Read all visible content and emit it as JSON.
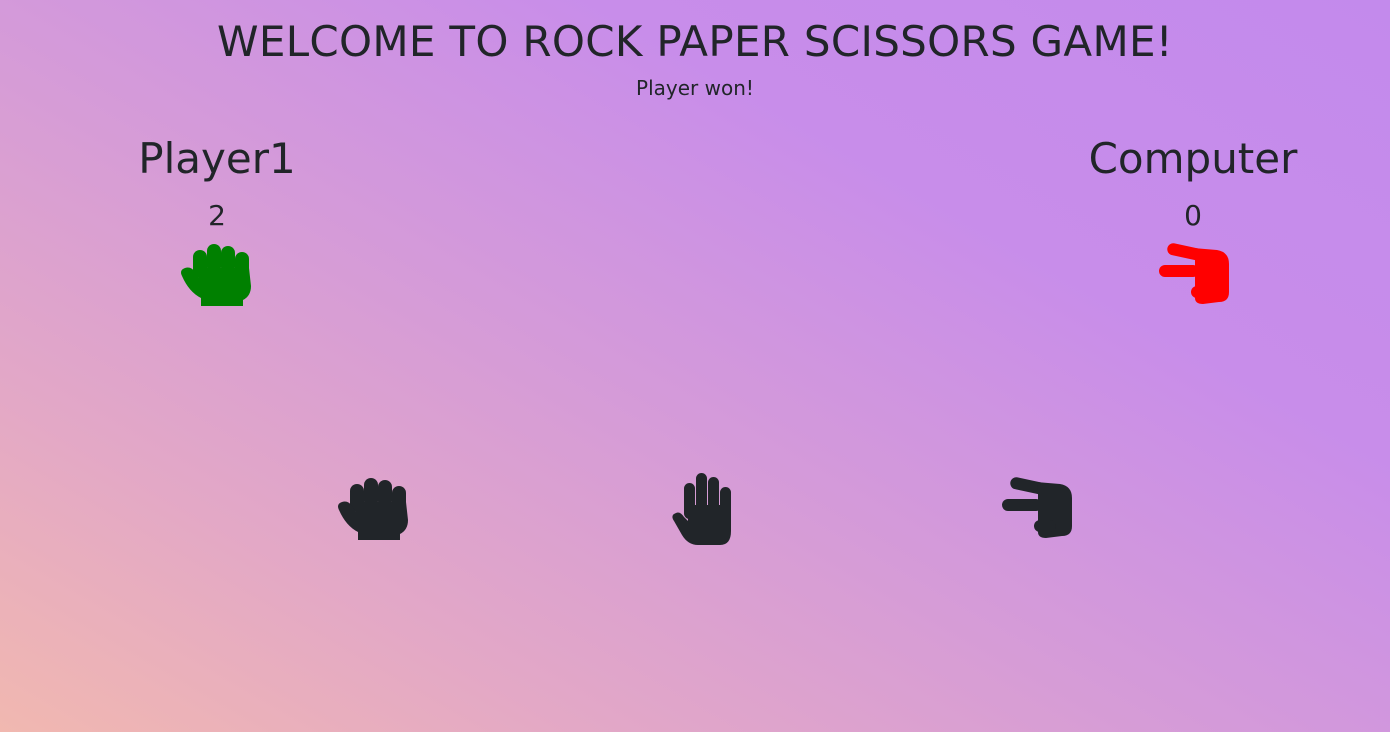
{
  "header": {
    "title": "WELCOME TO ROCK PAPER SCISSORS GAME!",
    "result": "Player won!"
  },
  "player": {
    "name": "Player1",
    "score": "2",
    "choice_icon": "rock-icon",
    "choice_color": "#008000"
  },
  "computer": {
    "name": "Computer",
    "score": "0",
    "choice_icon": "scissors-icon",
    "choice_color": "#ff0000"
  },
  "choices": [
    {
      "name": "rock",
      "icon": "rock-icon"
    },
    {
      "name": "paper",
      "icon": "paper-icon"
    },
    {
      "name": "scissors",
      "icon": "scissors-icon"
    }
  ],
  "colors": {
    "text": "#212529",
    "gradient_start": "#f1b8b0",
    "gradient_end": "#c38aec"
  }
}
